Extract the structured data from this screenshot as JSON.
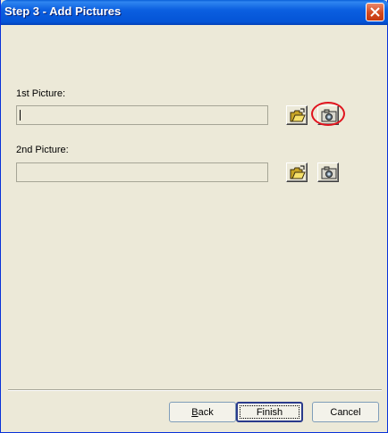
{
  "window": {
    "title": "Step 3 - Add Pictures"
  },
  "fields": [
    {
      "label": "1st Picture:",
      "value": ""
    },
    {
      "label": "2nd Picture:",
      "value": ""
    }
  ],
  "buttons": {
    "back_prefix": "",
    "back_mnemonic": "B",
    "back_rest": "ack",
    "finish": "Finish",
    "cancel": "Cancel"
  },
  "icons": {
    "browse": "open-folder-icon",
    "capture": "camera-icon"
  },
  "colors": {
    "titlebar": "#0454d6",
    "highlight": "#e0141e",
    "dialog_bg": "#ece9d8"
  }
}
